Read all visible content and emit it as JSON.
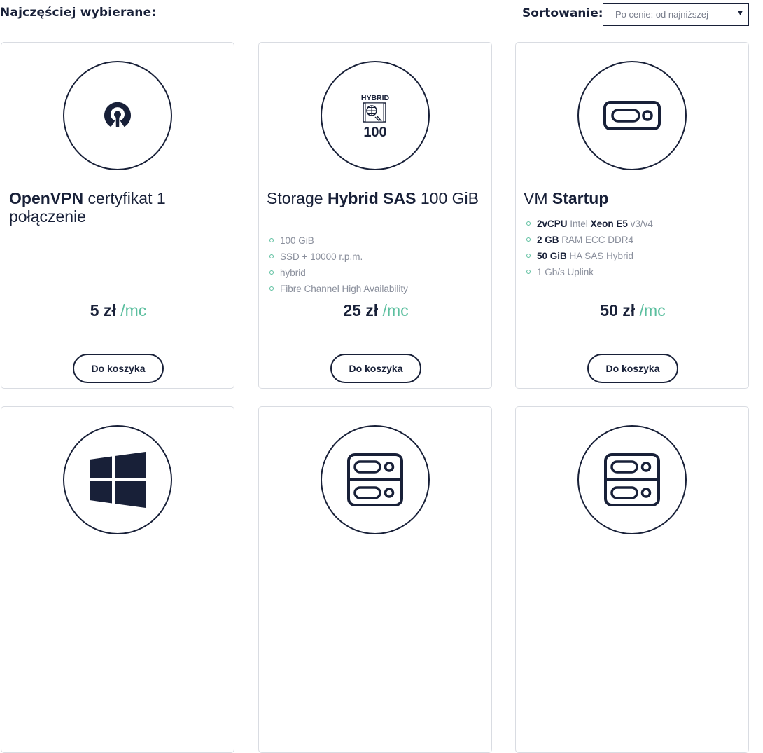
{
  "header": {
    "section_title": "Najczęściej wybierane:",
    "sort_label": "Sortowanie:",
    "sort_value": "Po cenie: od najniższej"
  },
  "products": [
    {
      "icon": "openvpn-icon",
      "title_bold": "OpenVPN",
      "title_rest": " certyfikat 1 połączenie",
      "features": [],
      "price": "5 zł",
      "price_unit": "/mc",
      "button": "Do koszyka"
    },
    {
      "icon": "hybrid-storage-icon",
      "icon_text_top": "HYBRID",
      "icon_text_bottom": "100",
      "title_pre": "Storage ",
      "title_bold": "Hybrid SAS",
      "title_rest": " 100 GiB",
      "features": [
        "100 GiB",
        "SSD + 10000 r.p.m.",
        "hybrid",
        "Fibre Channel High Availability"
      ],
      "price": "25 zł",
      "price_unit": "/mc",
      "button": "Do koszyka"
    },
    {
      "icon": "server-icon",
      "title_pre": "VM ",
      "title_bold": "Startup",
      "features": [
        {
          "b1": "2vCPU",
          "t1": " Intel ",
          "b2": "Xeon E5",
          "t2": " v3/v4"
        },
        {
          "b1": "2 GB",
          "t1": " RAM ECC DDR4"
        },
        {
          "b1": "50 GiB",
          "t1": " HA SAS Hybrid"
        },
        {
          "t1": "1 Gb/s Uplink"
        }
      ],
      "price": "50 zł",
      "price_unit": "/mc",
      "button": "Do koszyka"
    },
    {
      "icon": "windows-icon"
    },
    {
      "icon": "server-rack-icon"
    },
    {
      "icon": "server-rack-icon"
    }
  ]
}
